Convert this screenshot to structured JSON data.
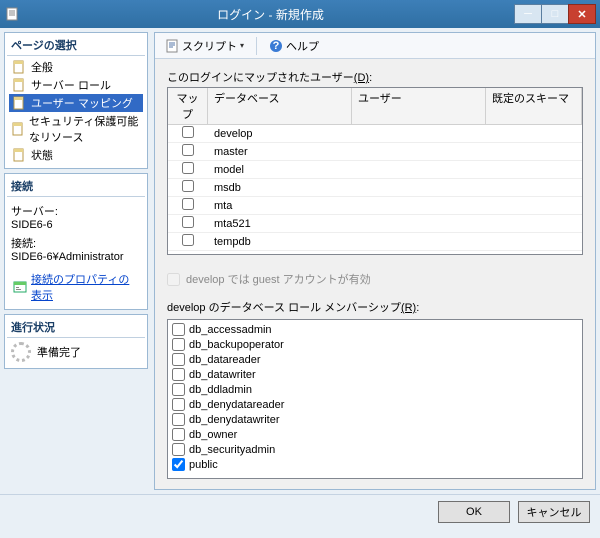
{
  "window": {
    "title": "ログイン - 新規作成"
  },
  "leftpanel": {
    "pages_header": "ページの選択",
    "nav": [
      {
        "label": "全般"
      },
      {
        "label": "サーバー ロール"
      },
      {
        "label": "ユーザー マッピング"
      },
      {
        "label": "セキュリティ保護可能なリソース"
      },
      {
        "label": "状態"
      }
    ],
    "connection_header": "接続",
    "server_label": "サーバー:",
    "server_value": "SIDE6-6",
    "conn_label": "接続:",
    "conn_value": "SIDE6-6¥Administrator",
    "view_link": "接続のプロパティの表示",
    "progress_header": "進行状況",
    "progress_status": "準備完了"
  },
  "toolbar": {
    "script": "スクリプト",
    "help": "ヘルプ"
  },
  "main": {
    "mapped_users_label": "このログインにマップされたユーザー",
    "mapped_users_key": "(D)",
    "columns": {
      "map": "マップ",
      "database": "データベース",
      "user": "ユーザー",
      "schema": "既定のスキーマ"
    },
    "rows": [
      {
        "db": "develop"
      },
      {
        "db": "master"
      },
      {
        "db": "model"
      },
      {
        "db": "msdb"
      },
      {
        "db": "mta"
      },
      {
        "db": "mta521"
      },
      {
        "db": "tempdb"
      }
    ],
    "guest_label": "develop では guest アカウントが有効",
    "roles_label": "develop のデータベース ロール メンバーシップ",
    "roles_key": "(R)",
    "roles": [
      {
        "name": "db_accessadmin",
        "checked": false
      },
      {
        "name": "db_backupoperator",
        "checked": false
      },
      {
        "name": "db_datareader",
        "checked": false
      },
      {
        "name": "db_datawriter",
        "checked": false
      },
      {
        "name": "db_ddladmin",
        "checked": false
      },
      {
        "name": "db_denydatareader",
        "checked": false
      },
      {
        "name": "db_denydatawriter",
        "checked": false
      },
      {
        "name": "db_owner",
        "checked": false
      },
      {
        "name": "db_securityadmin",
        "checked": false
      },
      {
        "name": "public",
        "checked": true
      }
    ]
  },
  "footer": {
    "ok": "OK",
    "cancel": "キャンセル"
  }
}
